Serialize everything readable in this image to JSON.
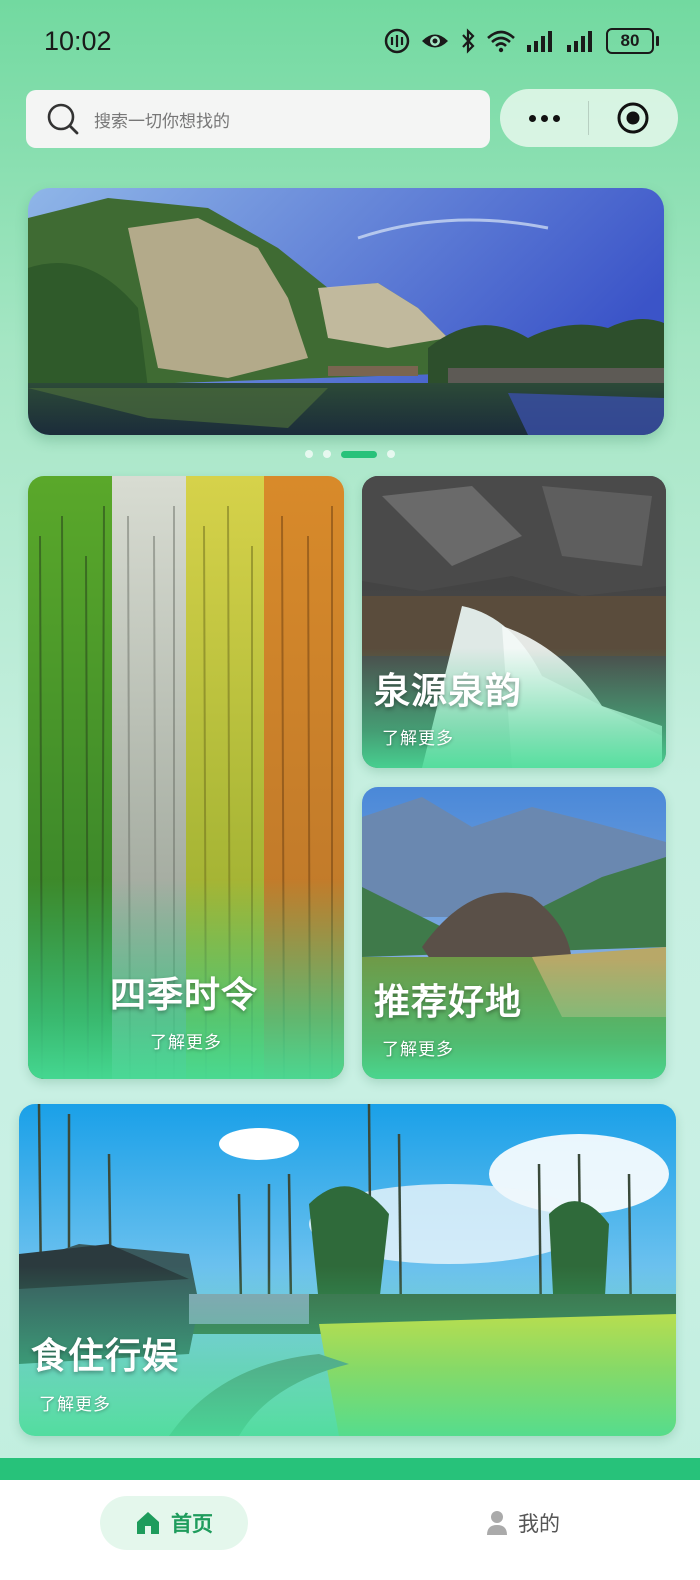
{
  "status_bar": {
    "time": "10:02",
    "battery": "80"
  },
  "search": {
    "placeholder": "搜索一切你想找的"
  },
  "banner": {
    "page_count": 4,
    "active_index": 2
  },
  "cards": {
    "seasons": {
      "title": "四季时令",
      "more": "了解更多"
    },
    "spring": {
      "title": "泉源泉韵",
      "more": "了解更多"
    },
    "recommend": {
      "title": "推荐好地",
      "more": "了解更多"
    },
    "life": {
      "title": "食住行娱",
      "more": "了解更多"
    }
  },
  "tabbar": {
    "home": {
      "label": "首页",
      "active": true
    },
    "me": {
      "label": "我的",
      "active": false
    }
  },
  "colors": {
    "accent": "#27c27a",
    "tab_active_text": "#1e9c5c",
    "tab_active_bg": "#e4f7ec"
  }
}
